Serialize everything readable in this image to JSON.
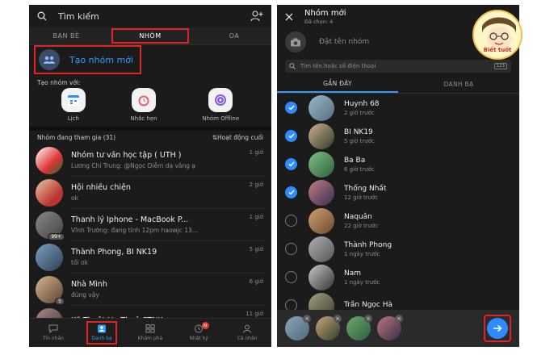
{
  "left": {
    "search_placeholder": "Tìm kiếm",
    "tabs": [
      "BẠN BÈ",
      "NHÓM",
      "OA"
    ],
    "create_group_label": "Tạo nhóm mới",
    "create_with_label": "Tạo nhóm với:",
    "quick_actions": [
      "Lịch",
      "Nhắc hẹn",
      "Nhóm Offline"
    ],
    "groups_header": "Nhóm đang tham gia (31)",
    "sort_label": "Hoạt động cuối",
    "chats": [
      {
        "name": "Nhóm tư vấn học tập ( UTH )",
        "msg": "Lương Chí Trung: @Ngọc Diễm dạ vâng ạ",
        "time": "1 giờ",
        "badge": ""
      },
      {
        "name": "Hội nhiều chiện",
        "msg": "ok",
        "time": "2 giờ",
        "badge": ""
      },
      {
        "name": "Thanh lý Iphone - MacBook P...",
        "msg": "Vĩnh Trường: đang tính 12pm haowjc 13...",
        "time": "1 giờ",
        "badge": "99+"
      },
      {
        "name": "Thành Phong, BI NK19",
        "msg": "tối ok",
        "time": "5 giờ",
        "badge": ""
      },
      {
        "name": "Nhà Mình",
        "msg": "đúng vậy",
        "time": "6 giờ",
        "badge": "5"
      },
      {
        "name": "Kỹ Thuật Hạ Thuỷ CTNK",
        "msg": "",
        "time": "11 giờ",
        "badge": ""
      }
    ],
    "nav": [
      "Tin nhắn",
      "Danh bạ",
      "Khám phá",
      "Nhật ký",
      "Cá nhân"
    ],
    "nav_badge": "N"
  },
  "right": {
    "title": "Nhóm mới",
    "subtitle": "Đã chọn: 4",
    "name_placeholder": "Đặt tên nhóm",
    "search_placeholder": "Tìm tên hoặc số điện thoại",
    "keypad_label": "123",
    "tabs": [
      "GẦN ĐÂY",
      "DANH BẠ"
    ],
    "contacts": [
      {
        "name": "Huynh 68",
        "sub": "2 giờ trước",
        "checked": true
      },
      {
        "name": "BI NK19",
        "sub": "5 giờ trước",
        "checked": true
      },
      {
        "name": "Ba Ba",
        "sub": "6 giờ trước",
        "checked": true
      },
      {
        "name": "Thống Nhất",
        "sub": "12 giờ trước",
        "checked": true
      },
      {
        "name": "Naquân",
        "sub": "22 giờ trước",
        "checked": false
      },
      {
        "name": "Thành Phong",
        "sub": "1 ngày trước",
        "checked": false
      },
      {
        "name": "Nam",
        "sub": "1 ngày trước",
        "checked": false
      },
      {
        "name": "Trần Ngọc Hà",
        "sub": "",
        "checked": false
      }
    ]
  },
  "logo_text": "Biết tuốt",
  "colors": {
    "accent": "#2f8bff",
    "highlight": "#e02424",
    "bg": "#1b1b1b"
  }
}
